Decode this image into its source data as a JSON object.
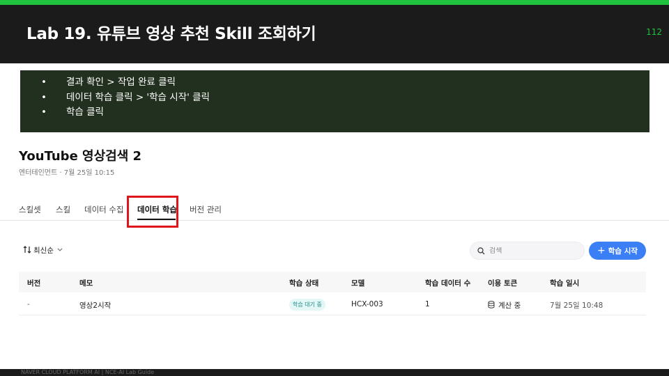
{
  "slide": {
    "title": "Lab 19. 유튜브 영상 추천 Skill 조회하기",
    "page_number": "112",
    "footer": "NAVER CLOUD PLATFORM AI  |  NCE-AI Lab Guide",
    "accent_color": "#1fc33f",
    "highlight_color": "#e0141b"
  },
  "notes": [
    "결과 확인 > 작업 완료 클릭",
    "데이터 학습 클릭 > '학습 시작' 클릭",
    "학습 클릭"
  ],
  "app": {
    "title": "YouTube 영상검색 2",
    "subtitle": "엔터테인먼트 · 7월 25일 10:15"
  },
  "tabs": [
    {
      "label": "스킬셋",
      "active": false
    },
    {
      "label": "스킬",
      "active": false
    },
    {
      "label": "데이터 수집",
      "active": false
    },
    {
      "label": "데이터 학습",
      "active": true
    },
    {
      "label": "버전 관리",
      "active": false
    }
  ],
  "toolbar": {
    "sort_label": "최신순",
    "sort_icon": "sort-arrows-icon",
    "search_placeholder": "검색",
    "search_icon": "search-icon",
    "train_button_label": "학습 시작",
    "train_button_color": "#3a7ff5"
  },
  "table": {
    "columns": [
      "버전",
      "메모",
      "학습 상태",
      "모델",
      "학습 데이터 수",
      "이용 토큰",
      "학습 일시"
    ],
    "rows": [
      {
        "version": "-",
        "memo": "영상2시작",
        "status": "학습 대기 중",
        "model": "HCX-003",
        "data_count": "1",
        "token": "계산 중",
        "token_icon": "database-icon",
        "datetime": "7월 25일 10:48"
      }
    ]
  }
}
